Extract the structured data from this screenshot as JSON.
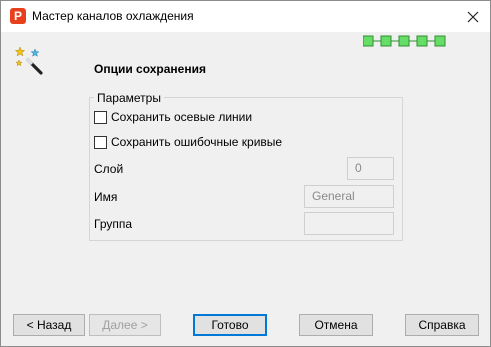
{
  "window": {
    "title": "Мастер каналов охлаждения",
    "app_icon_letter": "P"
  },
  "wizard": {
    "step_heading": "Опции сохранения",
    "progress": {
      "total_steps": 5,
      "current_step": 5,
      "color": "#66dd66"
    }
  },
  "parameters": {
    "group_title": "Параметры",
    "save_axes_label": "Сохранить осевые линии",
    "save_axes_checked": false,
    "save_error_curves_label": "Сохранить ошибочные кривые",
    "save_error_curves_checked": false,
    "layer_label": "Слой",
    "layer_value": "0",
    "name_label": "Имя",
    "name_value": "General",
    "group_label": "Группа",
    "group_value": ""
  },
  "buttons": {
    "back": "< Назад",
    "next": "Далее >",
    "finish": "Готово",
    "cancel": "Отмена",
    "help": "Справка"
  },
  "colors": {
    "accent": "#0078d7",
    "app_icon": "#e8401c"
  }
}
